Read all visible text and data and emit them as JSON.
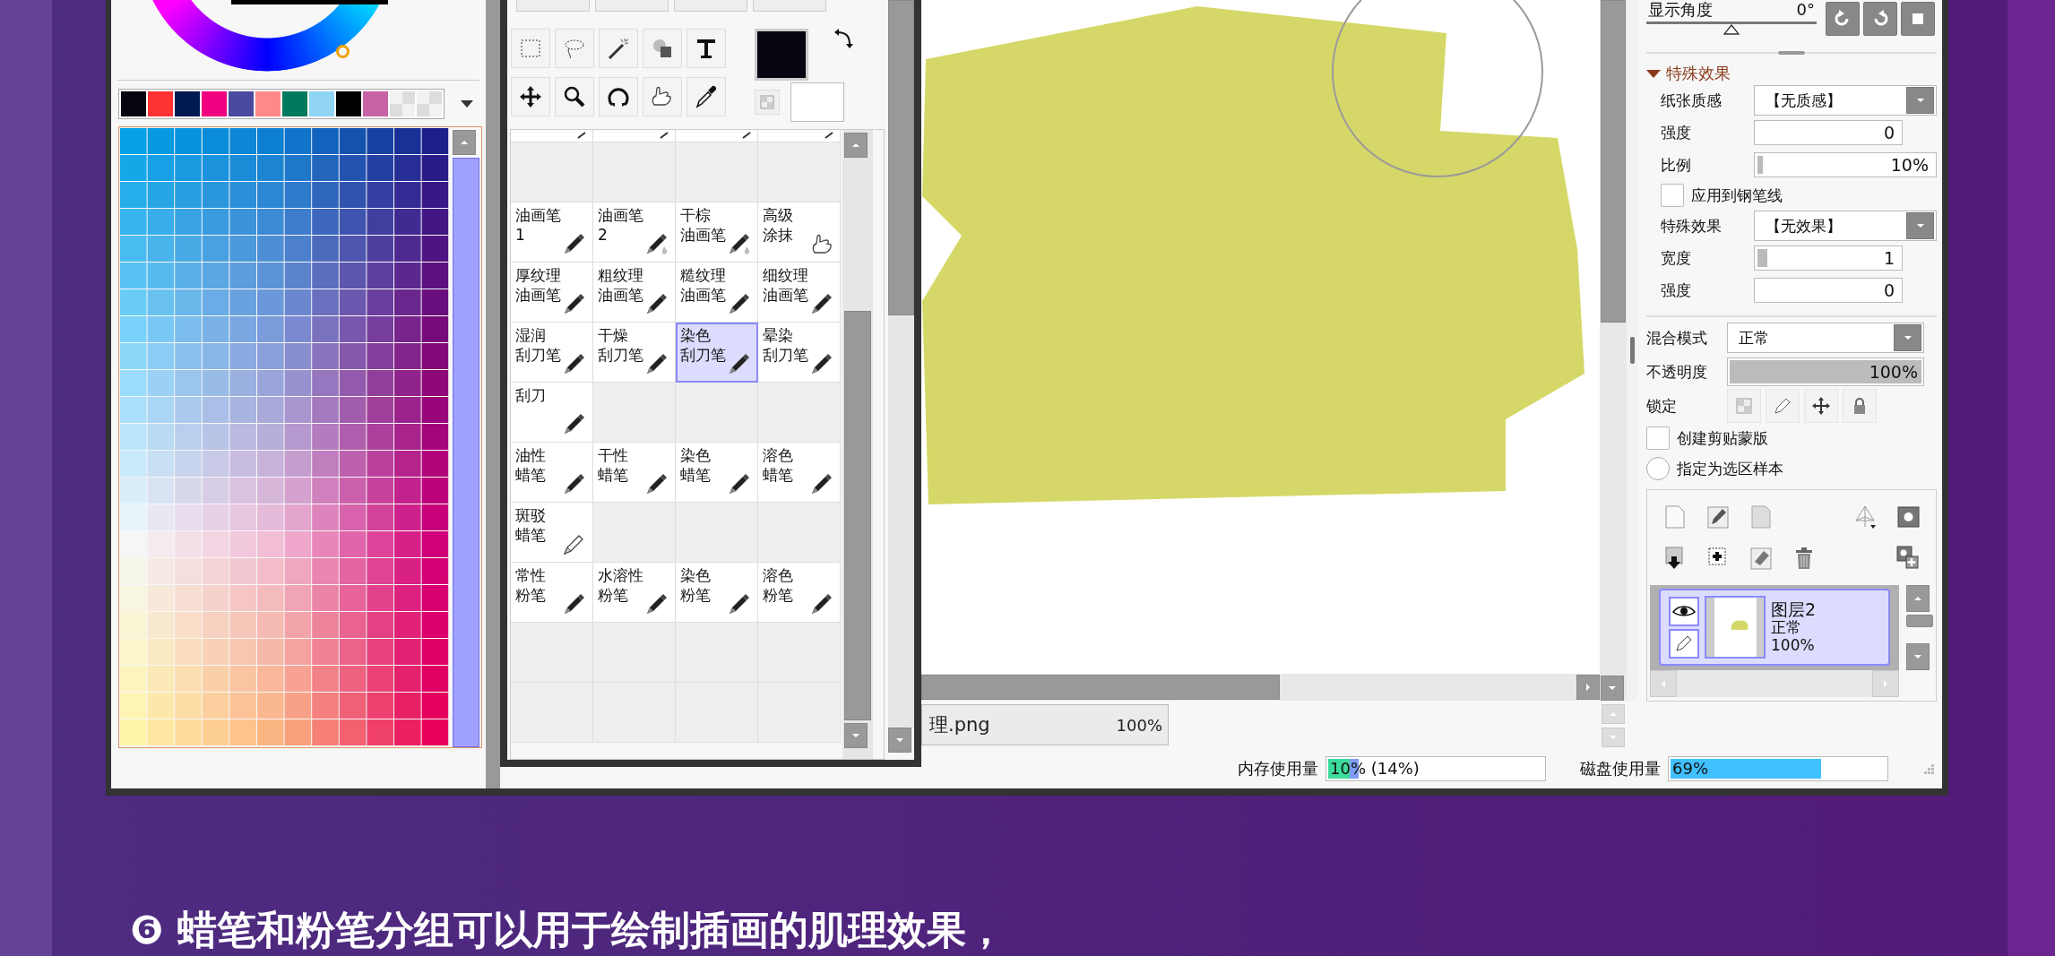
{
  "palette_panel": {
    "recent_colors": [
      {
        "color": "#05060f"
      },
      {
        "color": "#ff3333"
      },
      {
        "color": "#001a50"
      },
      {
        "color": "#f00080"
      },
      {
        "color": "#4a4aa0"
      },
      {
        "color": "#ff8888"
      },
      {
        "color": "#007a5c"
      },
      {
        "color": "#90d4f4"
      },
      {
        "color": "#000000"
      },
      {
        "color": "#c864a6"
      }
    ]
  },
  "brush_panel": {
    "brush_rows": [
      [
        {
          "kind": "stub",
          "selected": false
        },
        {
          "kind": "stub",
          "selected": false
        },
        {
          "kind": "stub",
          "selected": false
        },
        {
          "kind": "stub",
          "selected": false
        }
      ],
      [
        {
          "kind": "empty"
        },
        {
          "kind": "empty"
        },
        {
          "kind": "empty"
        },
        {
          "kind": "empty"
        }
      ],
      [
        {
          "kind": "pen",
          "lines": [
            "油画笔",
            "1"
          ],
          "selected": false
        },
        {
          "kind": "wetpen",
          "lines": [
            "油画笔",
            "2"
          ],
          "selected": false
        },
        {
          "kind": "wetpen",
          "lines": [
            "干棕",
            "油画笔"
          ],
          "selected": false
        },
        {
          "kind": "smudge",
          "lines": [
            "高级",
            "涂抹"
          ],
          "selected": false
        }
      ],
      [
        {
          "kind": "pen",
          "lines": [
            "厚纹理",
            "油画笔"
          ],
          "selected": false
        },
        {
          "kind": "pen",
          "lines": [
            "粗纹理",
            "油画笔"
          ],
          "selected": false
        },
        {
          "kind": "pen",
          "lines": [
            "糙纹理",
            "油画笔"
          ],
          "selected": false
        },
        {
          "kind": "pen",
          "lines": [
            "细纹理",
            "油画笔"
          ],
          "selected": false
        }
      ],
      [
        {
          "kind": "pen",
          "lines": [
            "湿润",
            "刮刀笔"
          ],
          "selected": false
        },
        {
          "kind": "pen",
          "lines": [
            "干燥",
            "刮刀笔"
          ],
          "selected": false
        },
        {
          "kind": "pen",
          "lines": [
            "染色",
            "刮刀笔"
          ],
          "selected": true
        },
        {
          "kind": "pen",
          "lines": [
            "晕染",
            "刮刀笔"
          ],
          "selected": false
        }
      ],
      [
        {
          "kind": "pen",
          "lines": [
            "刮刀"
          ],
          "selected": false
        },
        {
          "kind": "empty"
        },
        {
          "kind": "empty"
        },
        {
          "kind": "empty"
        }
      ],
      [
        {
          "kind": "pen",
          "lines": [
            "油性",
            "蜡笔"
          ],
          "selected": false
        },
        {
          "kind": "pen",
          "lines": [
            "干性",
            "蜡笔"
          ],
          "selected": false
        },
        {
          "kind": "pen",
          "lines": [
            "染色",
            "蜡笔"
          ],
          "selected": false
        },
        {
          "kind": "pen",
          "lines": [
            "溶色",
            "蜡笔"
          ],
          "selected": false
        }
      ],
      [
        {
          "kind": "pencil",
          "lines": [
            "斑驳",
            "蜡笔"
          ],
          "selected": false
        },
        {
          "kind": "empty"
        },
        {
          "kind": "empty"
        },
        {
          "kind": "empty"
        }
      ],
      [
        {
          "kind": "pen",
          "lines": [
            "常性",
            "粉笔"
          ],
          "selected": false
        },
        {
          "kind": "pen",
          "lines": [
            "水溶性",
            "粉笔"
          ],
          "selected": false
        },
        {
          "kind": "pen",
          "lines": [
            "染色",
            "粉笔"
          ],
          "selected": false
        },
        {
          "kind": "pen",
          "lines": [
            "溶色",
            "粉笔"
          ],
          "selected": false
        }
      ],
      [
        {
          "kind": "empty"
        },
        {
          "kind": "empty"
        },
        {
          "kind": "empty"
        },
        {
          "kind": "empty"
        }
      ],
      [
        {
          "kind": "empty"
        },
        {
          "kind": "empty"
        },
        {
          "kind": "empty"
        },
        {
          "kind": "empty"
        }
      ]
    ]
  },
  "document_tab": {
    "name": "理.png",
    "zoom": "100%"
  },
  "right_panel": {
    "view_angle": {
      "label": "显示角度",
      "value": "0°"
    },
    "effects": {
      "title": "特殊效果",
      "expanded": true,
      "rows": [
        {
          "kind": "select",
          "label": "纸张质感",
          "value": "【无质感】"
        },
        {
          "kind": "number",
          "label": "强度",
          "value": "0"
        },
        {
          "kind": "slider",
          "label": "比例",
          "value": "10%",
          "level": 0.03
        },
        {
          "kind": "checkbox",
          "label": "应用到钢笔线",
          "checked": false
        },
        {
          "kind": "select",
          "label": "特殊效果",
          "value": "【无效果】"
        },
        {
          "kind": "slider",
          "label": "宽度",
          "value": "1",
          "level": 0.07
        },
        {
          "kind": "number",
          "label": "强度",
          "value": "0"
        }
      ]
    },
    "blend_mode": {
      "label": "混合模式",
      "value": "正常"
    },
    "opacity": {
      "label": "不透明度",
      "value": "100%",
      "level": 1
    },
    "lock": {
      "label": "锁定"
    },
    "clipping_mask": {
      "label": "创建剪贴蒙版",
      "checked": false
    },
    "selection_source": {
      "label": "指定为选区样本",
      "selected": false
    },
    "layers": [
      {
        "name": "图层2",
        "mode": "正常",
        "opacity": "100%",
        "selected": true,
        "visible": true
      }
    ]
  },
  "status_bar": {
    "memory": {
      "label": "内存使用量",
      "value": "10% (14%)",
      "level": 0.1,
      "peak": {
        "level": 0.14
      }
    },
    "disk": {
      "label": "磁盘使用量",
      "value": "69%",
      "level": 0.69
    }
  },
  "caption": "❻ 蜡笔和粉笔分组可以用于绘制插画的肌理效果，"
}
